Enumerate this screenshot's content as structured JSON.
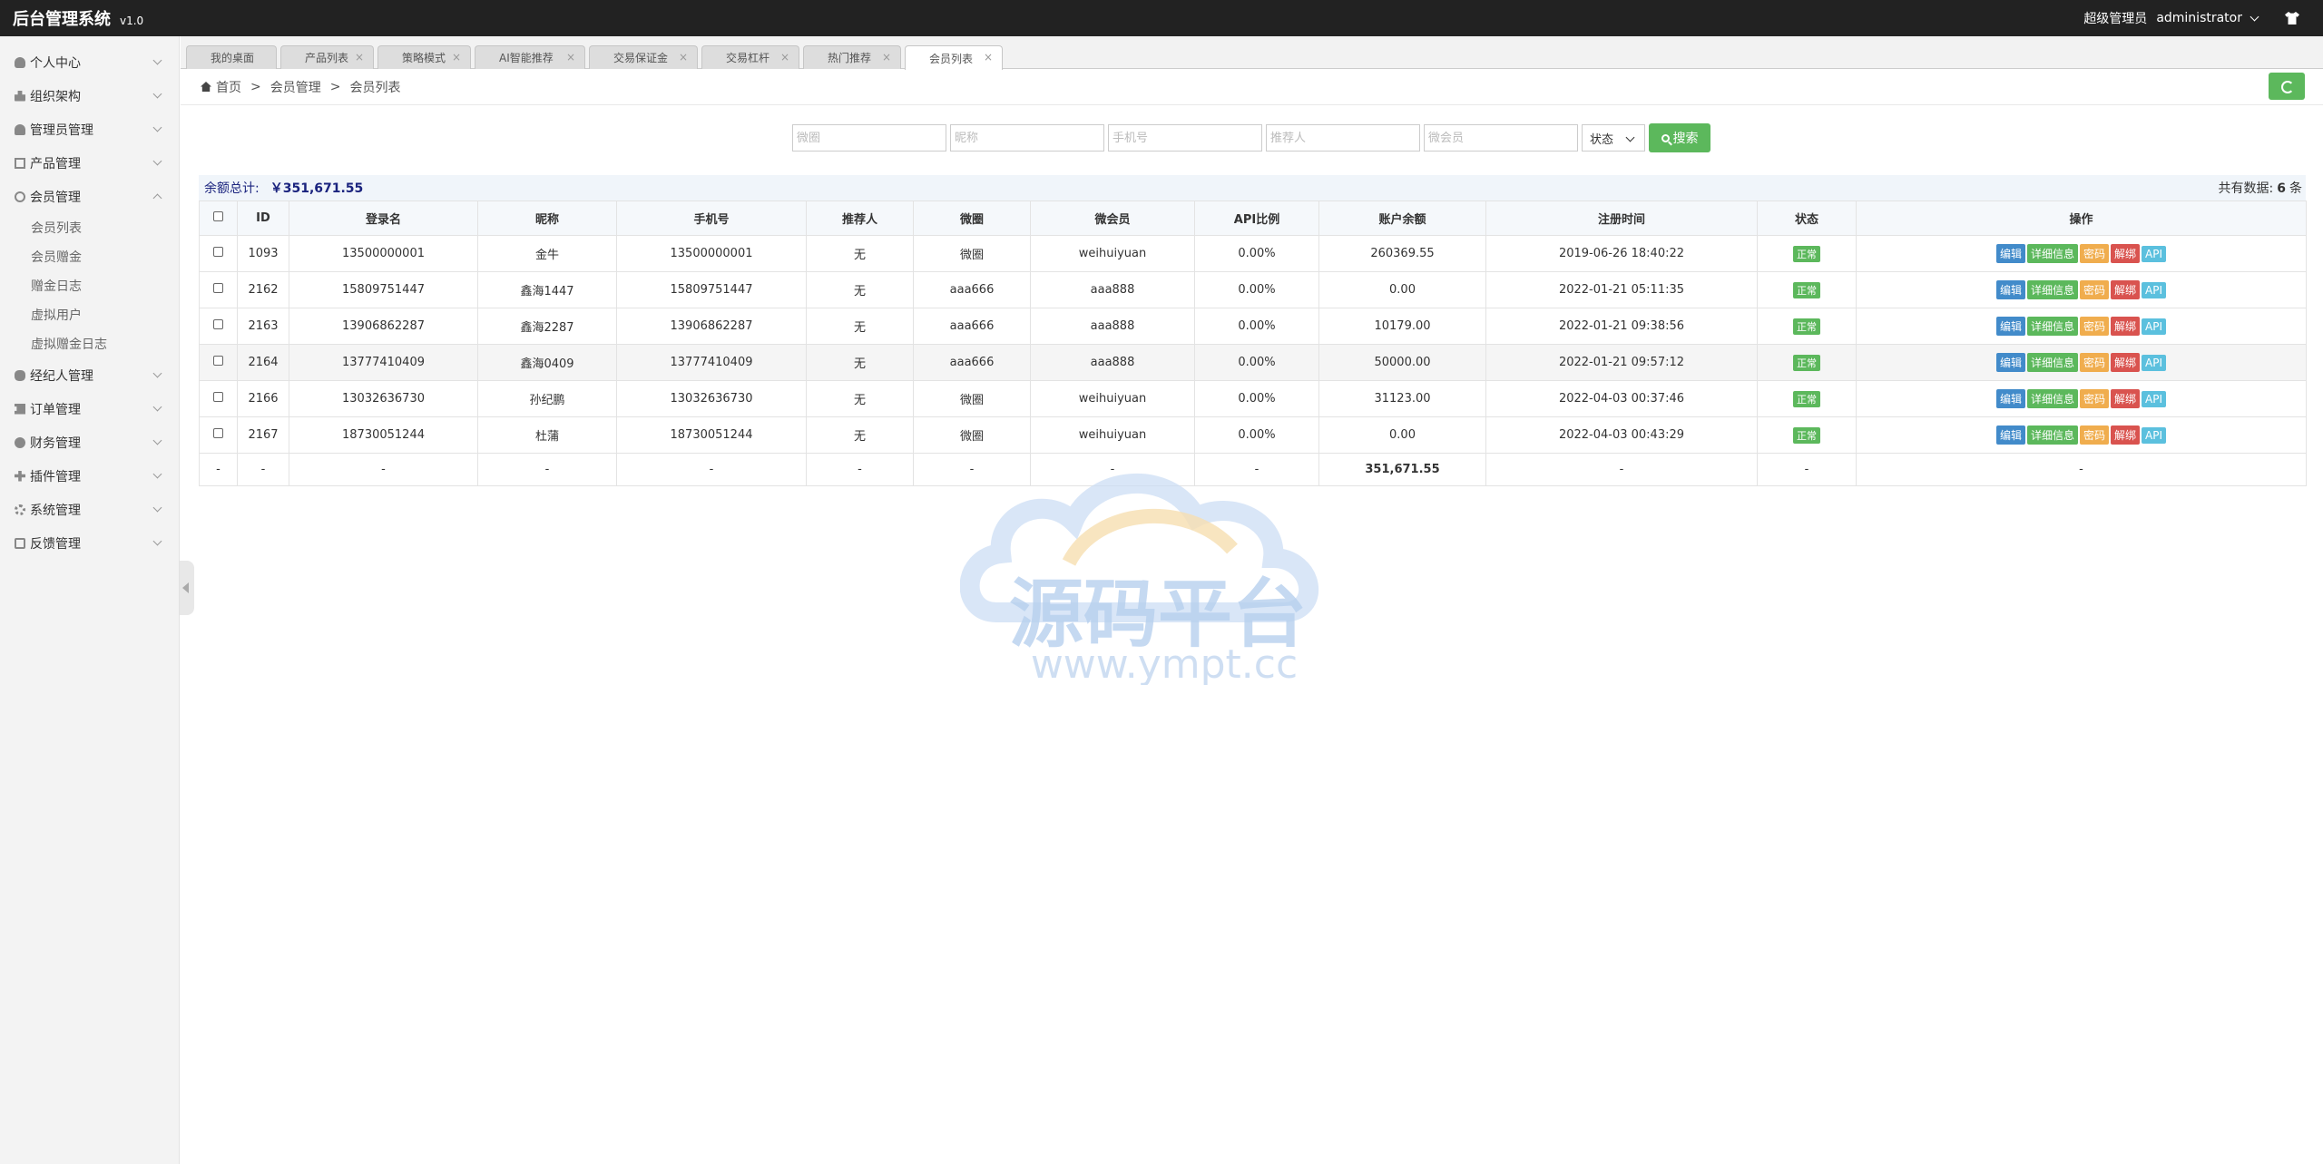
{
  "app": {
    "title": "后台管理系统",
    "version": "v1.0"
  },
  "header": {
    "role": "超级管理员",
    "username": "administrator"
  },
  "sidebar": {
    "items": [
      {
        "label": "个人中心",
        "icon": "user-icon"
      },
      {
        "label": "组织架构",
        "icon": "org-icon"
      },
      {
        "label": "管理员管理",
        "icon": "admin-icon"
      },
      {
        "label": "产品管理",
        "icon": "product-icon"
      },
      {
        "label": "会员管理",
        "icon": "member-icon",
        "expanded": true
      },
      {
        "label": "经纪人管理",
        "icon": "agent-icon"
      },
      {
        "label": "订单管理",
        "icon": "order-icon"
      },
      {
        "label": "财务管理",
        "icon": "finance-icon"
      },
      {
        "label": "插件管理",
        "icon": "plugin-icon"
      },
      {
        "label": "系统管理",
        "icon": "gear-icon"
      },
      {
        "label": "反馈管理",
        "icon": "feedback-icon"
      }
    ],
    "member_sub": [
      "会员列表",
      "会员赠金",
      "赠金日志",
      "虚拟用户",
      "虚拟赠金日志"
    ]
  },
  "tabs": [
    {
      "label": "我的桌面",
      "closable": false
    },
    {
      "label": "产品列表",
      "closable": true
    },
    {
      "label": "策略模式",
      "closable": true
    },
    {
      "label": "AI智能推荐",
      "closable": true
    },
    {
      "label": "交易保证金",
      "closable": true
    },
    {
      "label": "交易杠杆",
      "closable": true
    },
    {
      "label": "热门推荐",
      "closable": true
    },
    {
      "label": "会员列表",
      "closable": true,
      "active": true
    }
  ],
  "breadcrumb": [
    "首页",
    "会员管理",
    "会员列表"
  ],
  "search": {
    "placeholders": [
      "微圈",
      "昵称",
      "手机号",
      "推荐人",
      "微会员"
    ],
    "status_label": "状态",
    "button_label": "搜索"
  },
  "summary": {
    "label": "余额总计:",
    "amount": "￥351,671.55",
    "total_prefix": "共有数据:",
    "total_count": "6",
    "total_suffix": "条"
  },
  "table": {
    "headers": [
      "ID",
      "登录名",
      "昵称",
      "手机号",
      "推荐人",
      "微圈",
      "微会员",
      "API比例",
      "账户余额",
      "注册时间",
      "状态",
      "操作"
    ],
    "rows": [
      [
        "1093",
        "13500000001",
        "金牛",
        "13500000001",
        "无",
        "微圈",
        "weihuiyuan",
        "0.00%",
        "260369.55",
        "2019-06-26 18:40:22",
        "正常"
      ],
      [
        "2162",
        "15809751447",
        "鑫海1447",
        "15809751447",
        "无",
        "aaa666",
        "aaa888",
        "0.00%",
        "0.00",
        "2022-01-21 05:11:35",
        "正常"
      ],
      [
        "2163",
        "13906862287",
        "鑫海2287",
        "13906862287",
        "无",
        "aaa666",
        "aaa888",
        "0.00%",
        "10179.00",
        "2022-01-21 09:38:56",
        "正常"
      ],
      [
        "2164",
        "13777410409",
        "鑫海0409",
        "13777410409",
        "无",
        "aaa666",
        "aaa888",
        "0.00%",
        "50000.00",
        "2022-01-21 09:57:12",
        "正常"
      ],
      [
        "2166",
        "13032636730",
        "孙纪鹏",
        "13032636730",
        "无",
        "微圈",
        "weihuiyuan",
        "0.00%",
        "31123.00",
        "2022-04-03 00:37:46",
        "正常"
      ],
      [
        "2167",
        "18730051244",
        "杜蒲",
        "18730051244",
        "无",
        "微圈",
        "weihuiyuan",
        "0.00%",
        "0.00",
        "2022-04-03 00:43:29",
        "正常"
      ]
    ],
    "actions": [
      "编辑",
      "详细信息",
      "密码",
      "解绑",
      "API"
    ],
    "sum_row": [
      "-",
      "-",
      "-",
      "-",
      "-",
      "-",
      "-",
      "-",
      "-",
      "351,671.55",
      "-",
      "-",
      "-"
    ]
  },
  "watermark": {
    "cn": "源码平台",
    "url": "www.ympt.cc"
  },
  "colors": {
    "topbar": "#222222",
    "primary_green": "#5cb85c",
    "edit": "#428bca",
    "password": "#f0ad4e",
    "unbind": "#d9534f",
    "api": "#5bc0de"
  }
}
